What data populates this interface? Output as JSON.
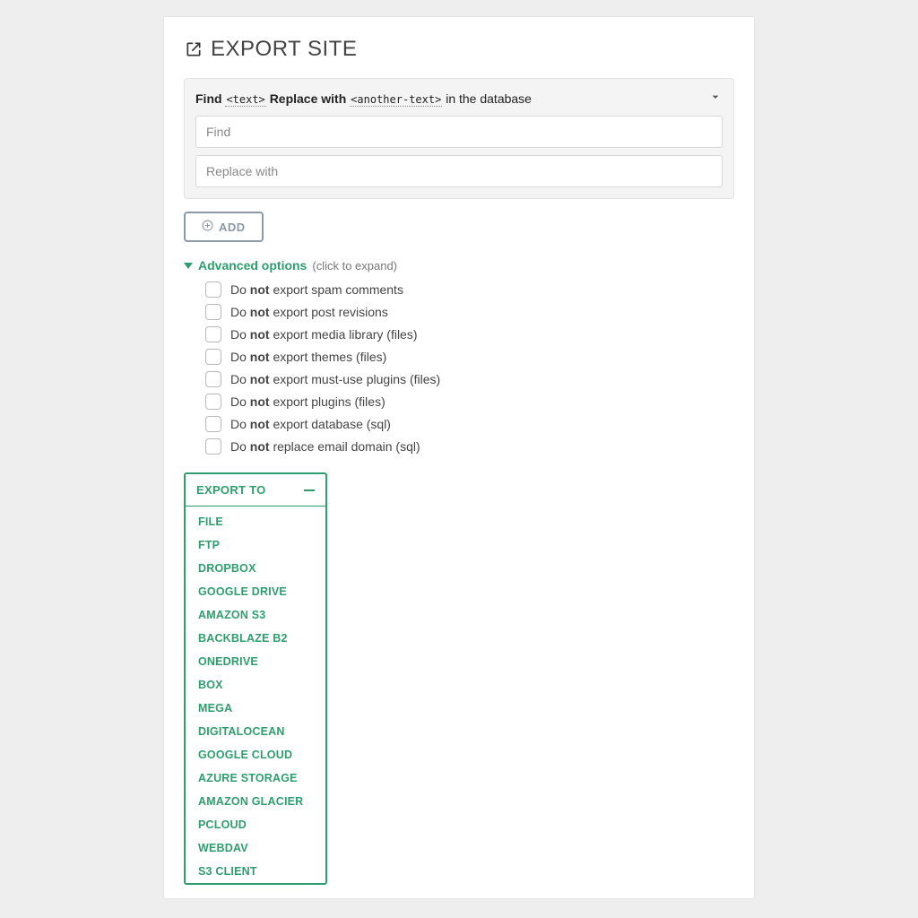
{
  "page_title": "EXPORT SITE",
  "find_replace": {
    "header_find_prefix": "Find",
    "header_tag1": "<text>",
    "header_replace": "Replace with",
    "header_tag2": "<another-text>",
    "header_suffix": "in the database",
    "placeholder_find": "Find",
    "placeholder_replace": "Replace with",
    "value_find": "",
    "value_replace": ""
  },
  "add_button_label": "ADD",
  "advanced": {
    "heading": "Advanced options",
    "hint": "(click to expand)",
    "options": [
      {
        "pre": "Do",
        "bold": "not",
        "post": "export spam comments"
      },
      {
        "pre": "Do",
        "bold": "not",
        "post": "export post revisions"
      },
      {
        "pre": "Do",
        "bold": "not",
        "post": "export media library (files)"
      },
      {
        "pre": "Do",
        "bold": "not",
        "post": "export themes (files)"
      },
      {
        "pre": "Do",
        "bold": "not",
        "post": "export must-use plugins (files)"
      },
      {
        "pre": "Do",
        "bold": "not",
        "post": "export plugins (files)"
      },
      {
        "pre": "Do",
        "bold": "not",
        "post": "export database (sql)"
      },
      {
        "pre": "Do",
        "bold": "not",
        "post": "replace email domain (sql)"
      }
    ]
  },
  "export_to": {
    "heading": "EXPORT TO",
    "items": [
      "FILE",
      "FTP",
      "DROPBOX",
      "GOOGLE DRIVE",
      "AMAZON S3",
      "BACKBLAZE B2",
      "ONEDRIVE",
      "BOX",
      "MEGA",
      "DIGITALOCEAN",
      "GOOGLE CLOUD",
      "AZURE STORAGE",
      "AMAZON GLACIER",
      "PCLOUD",
      "WEBDAV",
      "S3 CLIENT"
    ]
  }
}
